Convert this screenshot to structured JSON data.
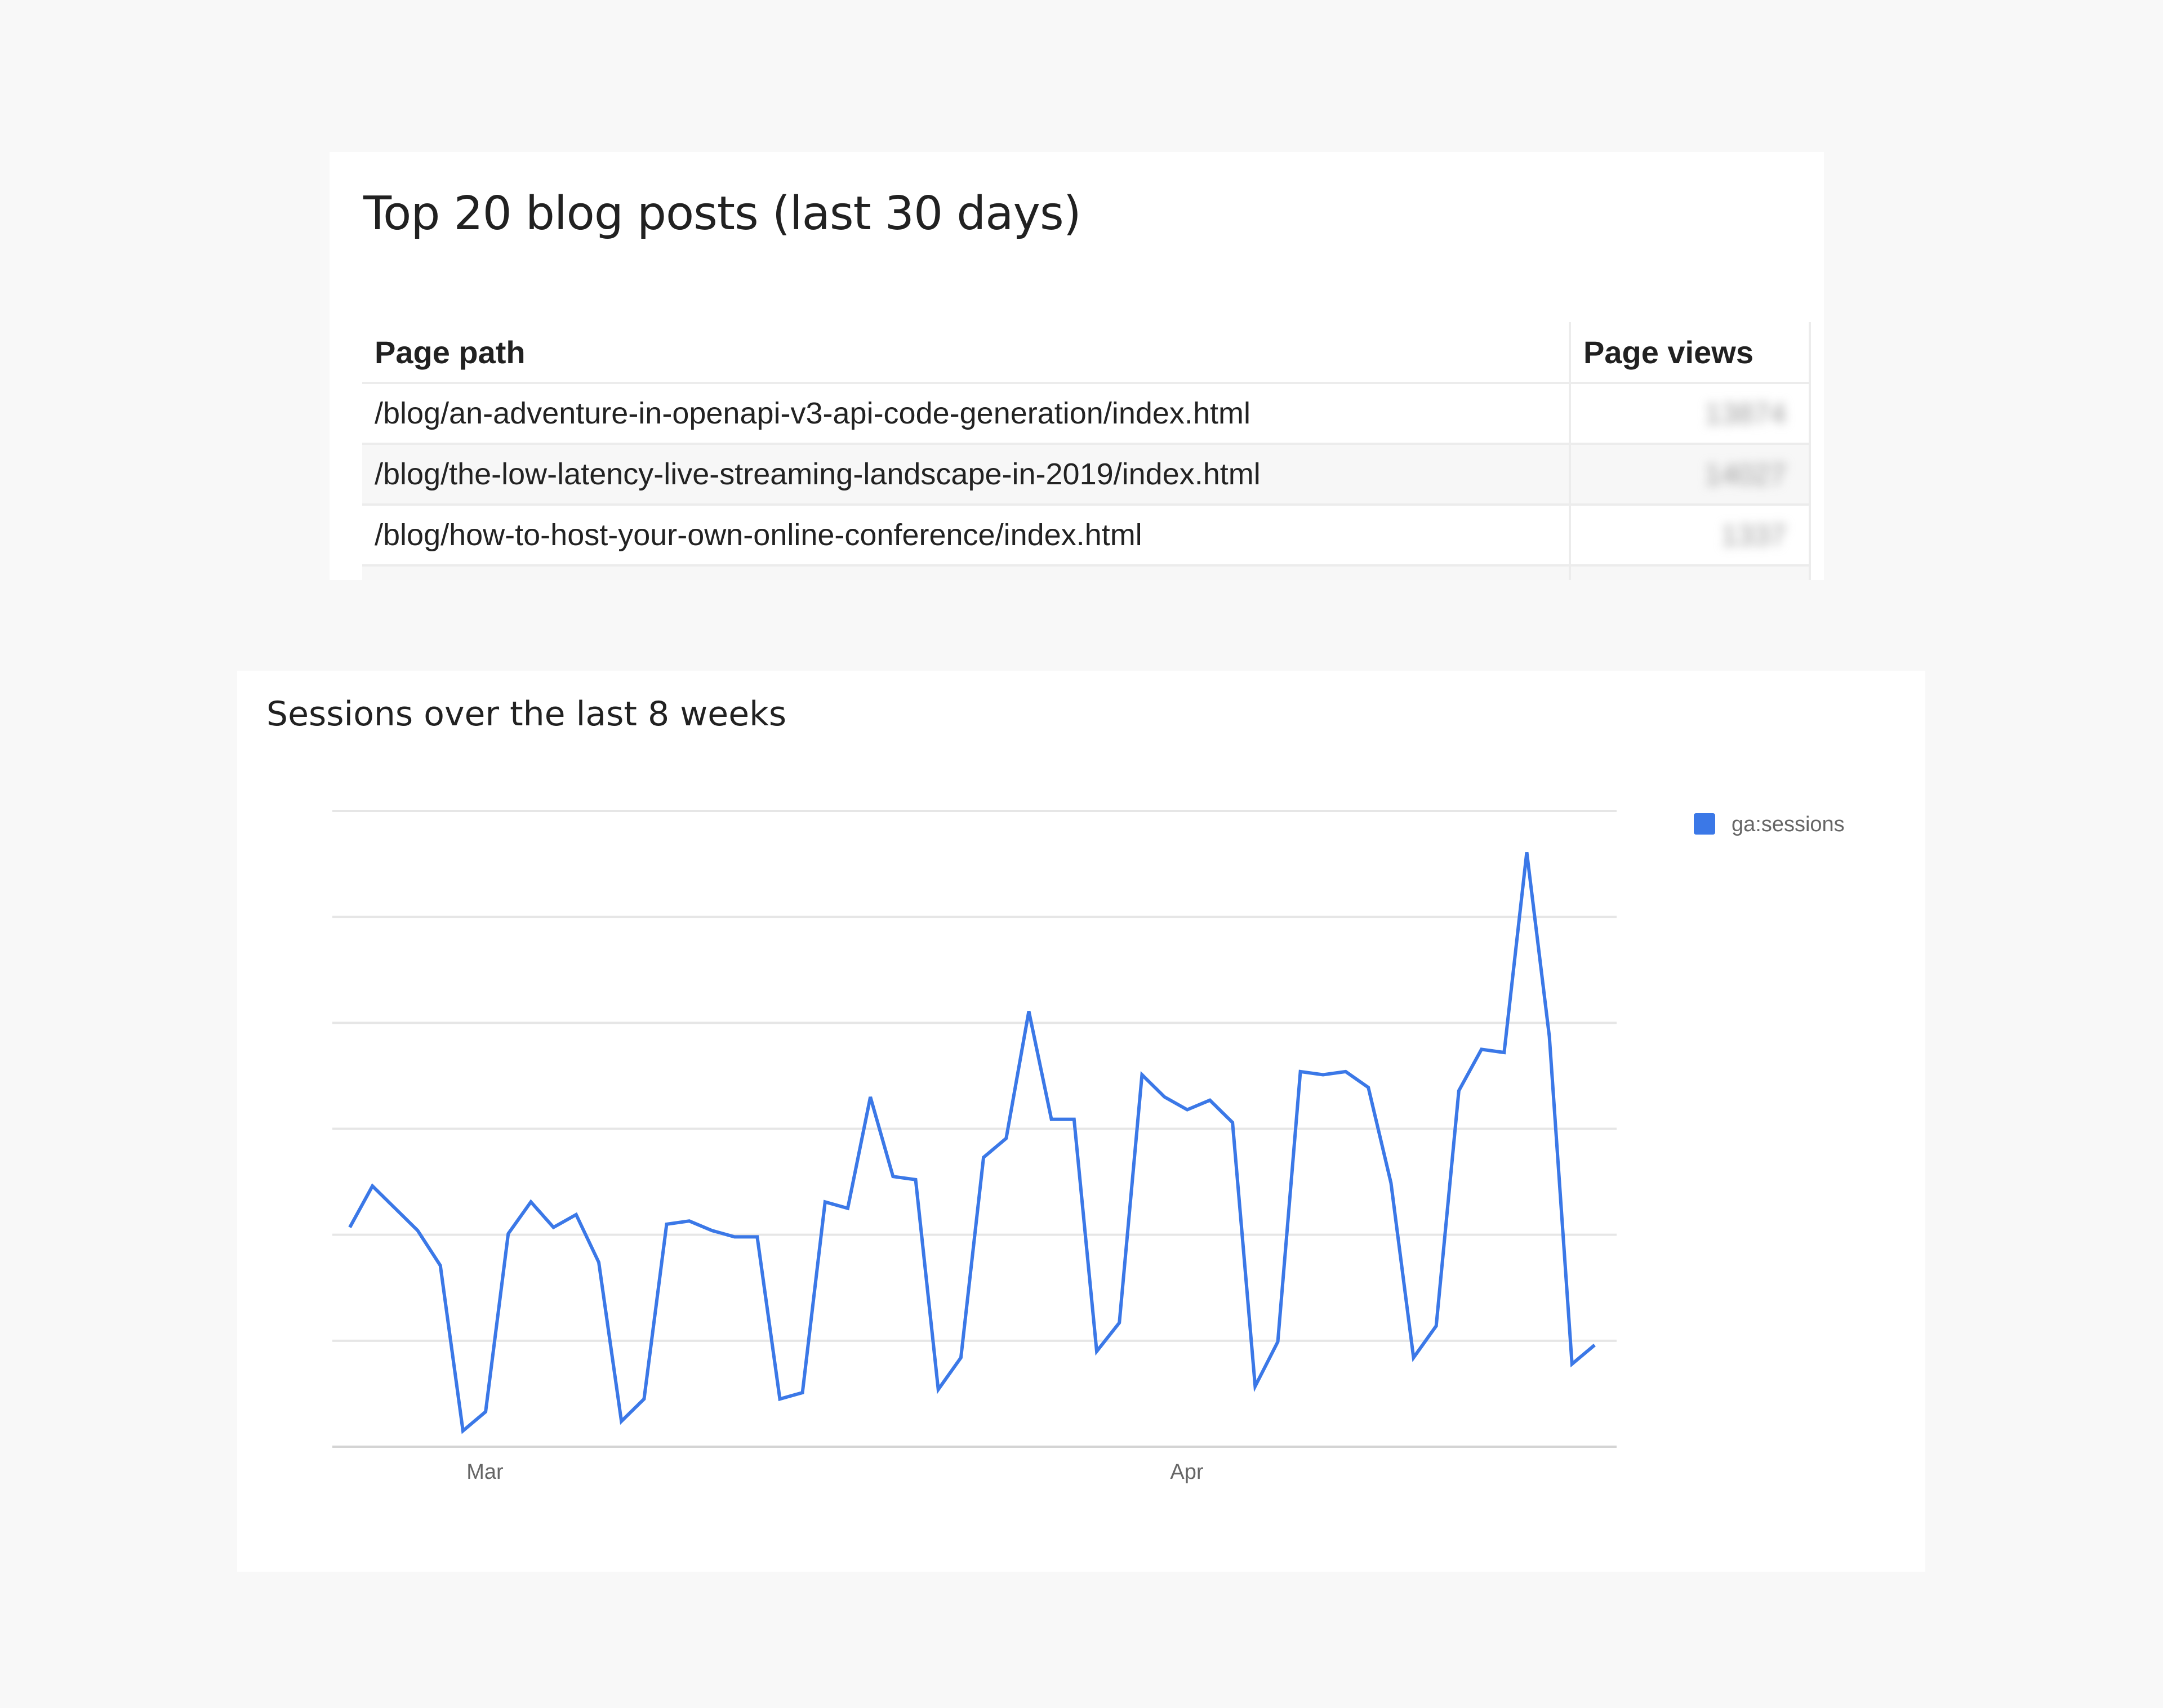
{
  "table_card": {
    "title": "Top 20 blog posts (last 30 days)",
    "columns": [
      "Page path",
      "Page views"
    ],
    "rows": [
      {
        "path": "/blog/an-adventure-in-openapi-v3-api-code-generation/index.html",
        "views": "13874"
      },
      {
        "path": "/blog/the-low-latency-live-streaming-landscape-in-2019/index.html",
        "views": "14027"
      },
      {
        "path": "/blog/how-to-host-your-own-online-conference/index.html",
        "views": "1337"
      }
    ]
  },
  "chart_card": {
    "title": "Sessions over the last 8 weeks",
    "chart_data": {
      "type": "line",
      "series": [
        {
          "name": "ga:sessions",
          "color": "#3b78e7",
          "values": [
            49,
            62,
            55,
            48,
            37,
            -15,
            -9,
            47,
            57,
            49,
            53,
            38,
            -12,
            -5,
            50,
            51,
            48,
            46,
            46,
            -5,
            -3,
            57,
            55,
            90,
            65,
            64,
            -2,
            8,
            71,
            77,
            117,
            83,
            83,
            10,
            19,
            97,
            90,
            86,
            89,
            82,
            -1,
            13,
            98,
            97,
            98,
            93,
            63,
            8,
            18,
            92,
            105,
            104,
            167,
            109,
            6,
            12
          ]
        }
      ],
      "x_tick_labels": [
        "Mar",
        "Apr"
      ],
      "legend_position": "top-right",
      "grid": true,
      "y_axis_labels_visible": false,
      "ylim": [
        -20,
        180
      ]
    }
  }
}
